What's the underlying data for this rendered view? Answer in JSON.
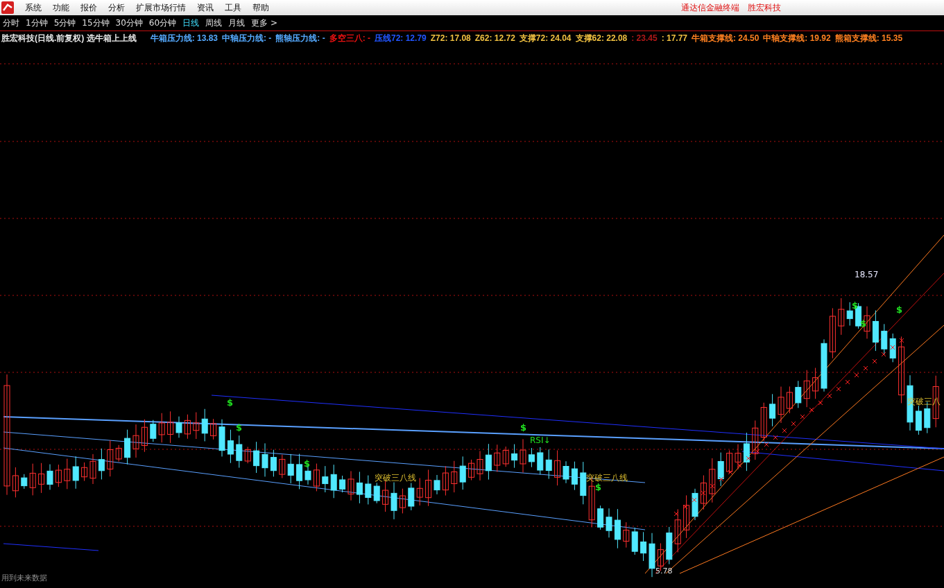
{
  "menu": {
    "items": [
      "系统",
      "功能",
      "报价",
      "分析",
      "扩展市场行情",
      "资讯",
      "工具",
      "帮助"
    ],
    "titles": [
      "通达信金融终端",
      "胜宏科技"
    ]
  },
  "periods": [
    {
      "label": "分时",
      "selected": false
    },
    {
      "label": "1分钟",
      "selected": false
    },
    {
      "label": "5分钟",
      "selected": false
    },
    {
      "label": "15分钟",
      "selected": false
    },
    {
      "label": "30分钟",
      "selected": false
    },
    {
      "label": "60分钟",
      "selected": false
    },
    {
      "label": "日线",
      "selected": true
    },
    {
      "label": "周线",
      "selected": false
    },
    {
      "label": "月线",
      "selected": false
    },
    {
      "label": "更多 >",
      "selected": false
    }
  ],
  "legend": [
    {
      "text": "胜宏科技(日线.前复权) 选牛箱上上线",
      "color": "#e8e8e8"
    },
    {
      "text": "牛箱压力线: 13.83",
      "color": "#55aaff"
    },
    {
      "text": "中轴压力线: -",
      "color": "#55aaff"
    },
    {
      "text": "熊轴压力线: -",
      "color": "#55aaff"
    },
    {
      "text": "多空三八: -",
      "color": "#ee1111"
    },
    {
      "text": "压线72: 12.79",
      "color": "#2255ff"
    },
    {
      "text": "Z72: 17.08",
      "color": "#f0c040"
    },
    {
      "text": "Z62: 12.72",
      "color": "#f0c040"
    },
    {
      "text": "支撑72: 24.04",
      "color": "#f0c040"
    },
    {
      "text": "支撑62: 22.08",
      "color": "#f0c040"
    },
    {
      "text": ": 23.45",
      "color": "#b01818"
    },
    {
      "text": ": 17.77",
      "color": "#f0c040"
    },
    {
      "text": "牛箱支撑线: 24.50",
      "color": "#ff8020"
    },
    {
      "text": "中轴支撑线: 19.92",
      "color": "#ff8020"
    },
    {
      "text": "熊箱支撑线: 15.35",
      "color": "#ff8020"
    }
  ],
  "chart": {
    "annotations": [
      {
        "kind": "high",
        "text": "18.57"
      },
      {
        "kind": "low",
        "text": "5.78"
      },
      {
        "kind": "signal",
        "text": "突破三八线"
      },
      {
        "kind": "signal",
        "text": "突破三八线"
      },
      {
        "kind": "signal",
        "text": "突破三八"
      },
      {
        "kind": "indicator",
        "text": "RSI↓"
      },
      {
        "kind": "mark",
        "text": "$"
      },
      {
        "kind": "mark",
        "text": "$"
      },
      {
        "kind": "mark",
        "text": "$"
      },
      {
        "kind": "mark",
        "text": "$"
      },
      {
        "kind": "mark",
        "text": "$"
      },
      {
        "kind": "mark",
        "text": "$"
      },
      {
        "kind": "mark",
        "text": "$"
      },
      {
        "kind": "mark",
        "text": "$"
      }
    ],
    "note": "用到未来数据"
  }
}
